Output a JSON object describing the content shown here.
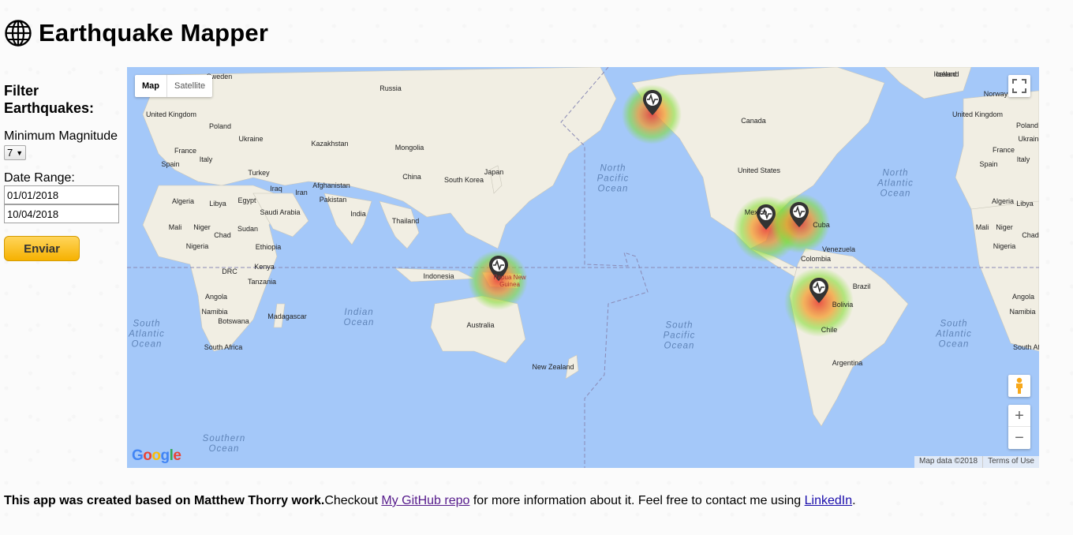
{
  "app": {
    "title": "Earthquake Mapper"
  },
  "sidebar": {
    "heading_line1": "Filter",
    "heading_line2": "Earthquakes:",
    "magnitude_label": "Minimum Magnitude",
    "magnitude_value": "7",
    "date_range_label": "Date Range:",
    "date_from": "01/01/2018",
    "date_to": "10/04/2018",
    "submit_label": "Enviar"
  },
  "map": {
    "type_map": "Map",
    "type_satellite": "Satellite",
    "zoom_in": "+",
    "zoom_out": "−",
    "google_logo": "Google",
    "map_data": "Map data ©2018",
    "terms": "Terms of Use",
    "oceans": [
      {
        "l1": "North",
        "l2": "Pacific",
        "l3": "Ocean"
      },
      {
        "l1": "North",
        "l2": "Atlantic",
        "l3": "Ocean"
      },
      {
        "l1": "South",
        "l2": "Pacific",
        "l3": "Ocean"
      },
      {
        "l1": "Indian",
        "l2": "Ocean",
        "l3": ""
      },
      {
        "l1": "South",
        "l2": "Atlantic",
        "l3": "Ocean"
      },
      {
        "l1": "South",
        "l2": "Atlantic",
        "l3": "Ocean"
      },
      {
        "l1": "Southern",
        "l2": "Ocean",
        "l3": ""
      }
    ],
    "places": [
      "Russia",
      "Canada",
      "United States",
      "Mexico",
      "Venezuela",
      "Colombia",
      "Brazil",
      "Bolivia",
      "Chile",
      "Argentina",
      "Sweden",
      "Iceland",
      "United Kingdom",
      "Poland",
      "Ukraine",
      "France",
      "Spain",
      "Italy",
      "Turkey",
      "Iraq",
      "Iran",
      "Afghanistan",
      "Pakistan",
      "Kazakhstan",
      "Mongolia",
      "China",
      "South Korea",
      "Japan",
      "India",
      "Thailand",
      "Indonesia",
      "Papua New Guinea",
      "Australia",
      "New Zealand",
      "Algeria",
      "Libya",
      "Egypt",
      "Saudi Arabia",
      "Mali",
      "Niger",
      "Chad",
      "Sudan",
      "Nigeria",
      "Ethiopia",
      "DRC",
      "Kenya",
      "Tanzania",
      "Angola",
      "Namibia",
      "Botswana",
      "Madagascar",
      "South Africa",
      "Iceland",
      "Norway",
      "United Kingdom",
      "Poland",
      "France",
      "Spain",
      "Italy",
      "Ukraine",
      "Algeria",
      "Libya",
      "Mali",
      "Niger",
      "Chad",
      "Nigeria",
      "Angola",
      "Namibia",
      "South Af",
      "Cuba"
    ],
    "marker_icon": "earthquake-marker-icon"
  },
  "footer": {
    "bold_text": "This app was created based on Matthew Thorry work.",
    "text1": "Checkout ",
    "github_link": "My GitHub repo",
    "text2": " for more information about it. Feel free to contact me using ",
    "linkedin_link": "LinkedIn",
    "text3": "."
  },
  "colors": {
    "water": "#a4c8f9",
    "land": "#f2efe5",
    "button": "#f6b100"
  }
}
